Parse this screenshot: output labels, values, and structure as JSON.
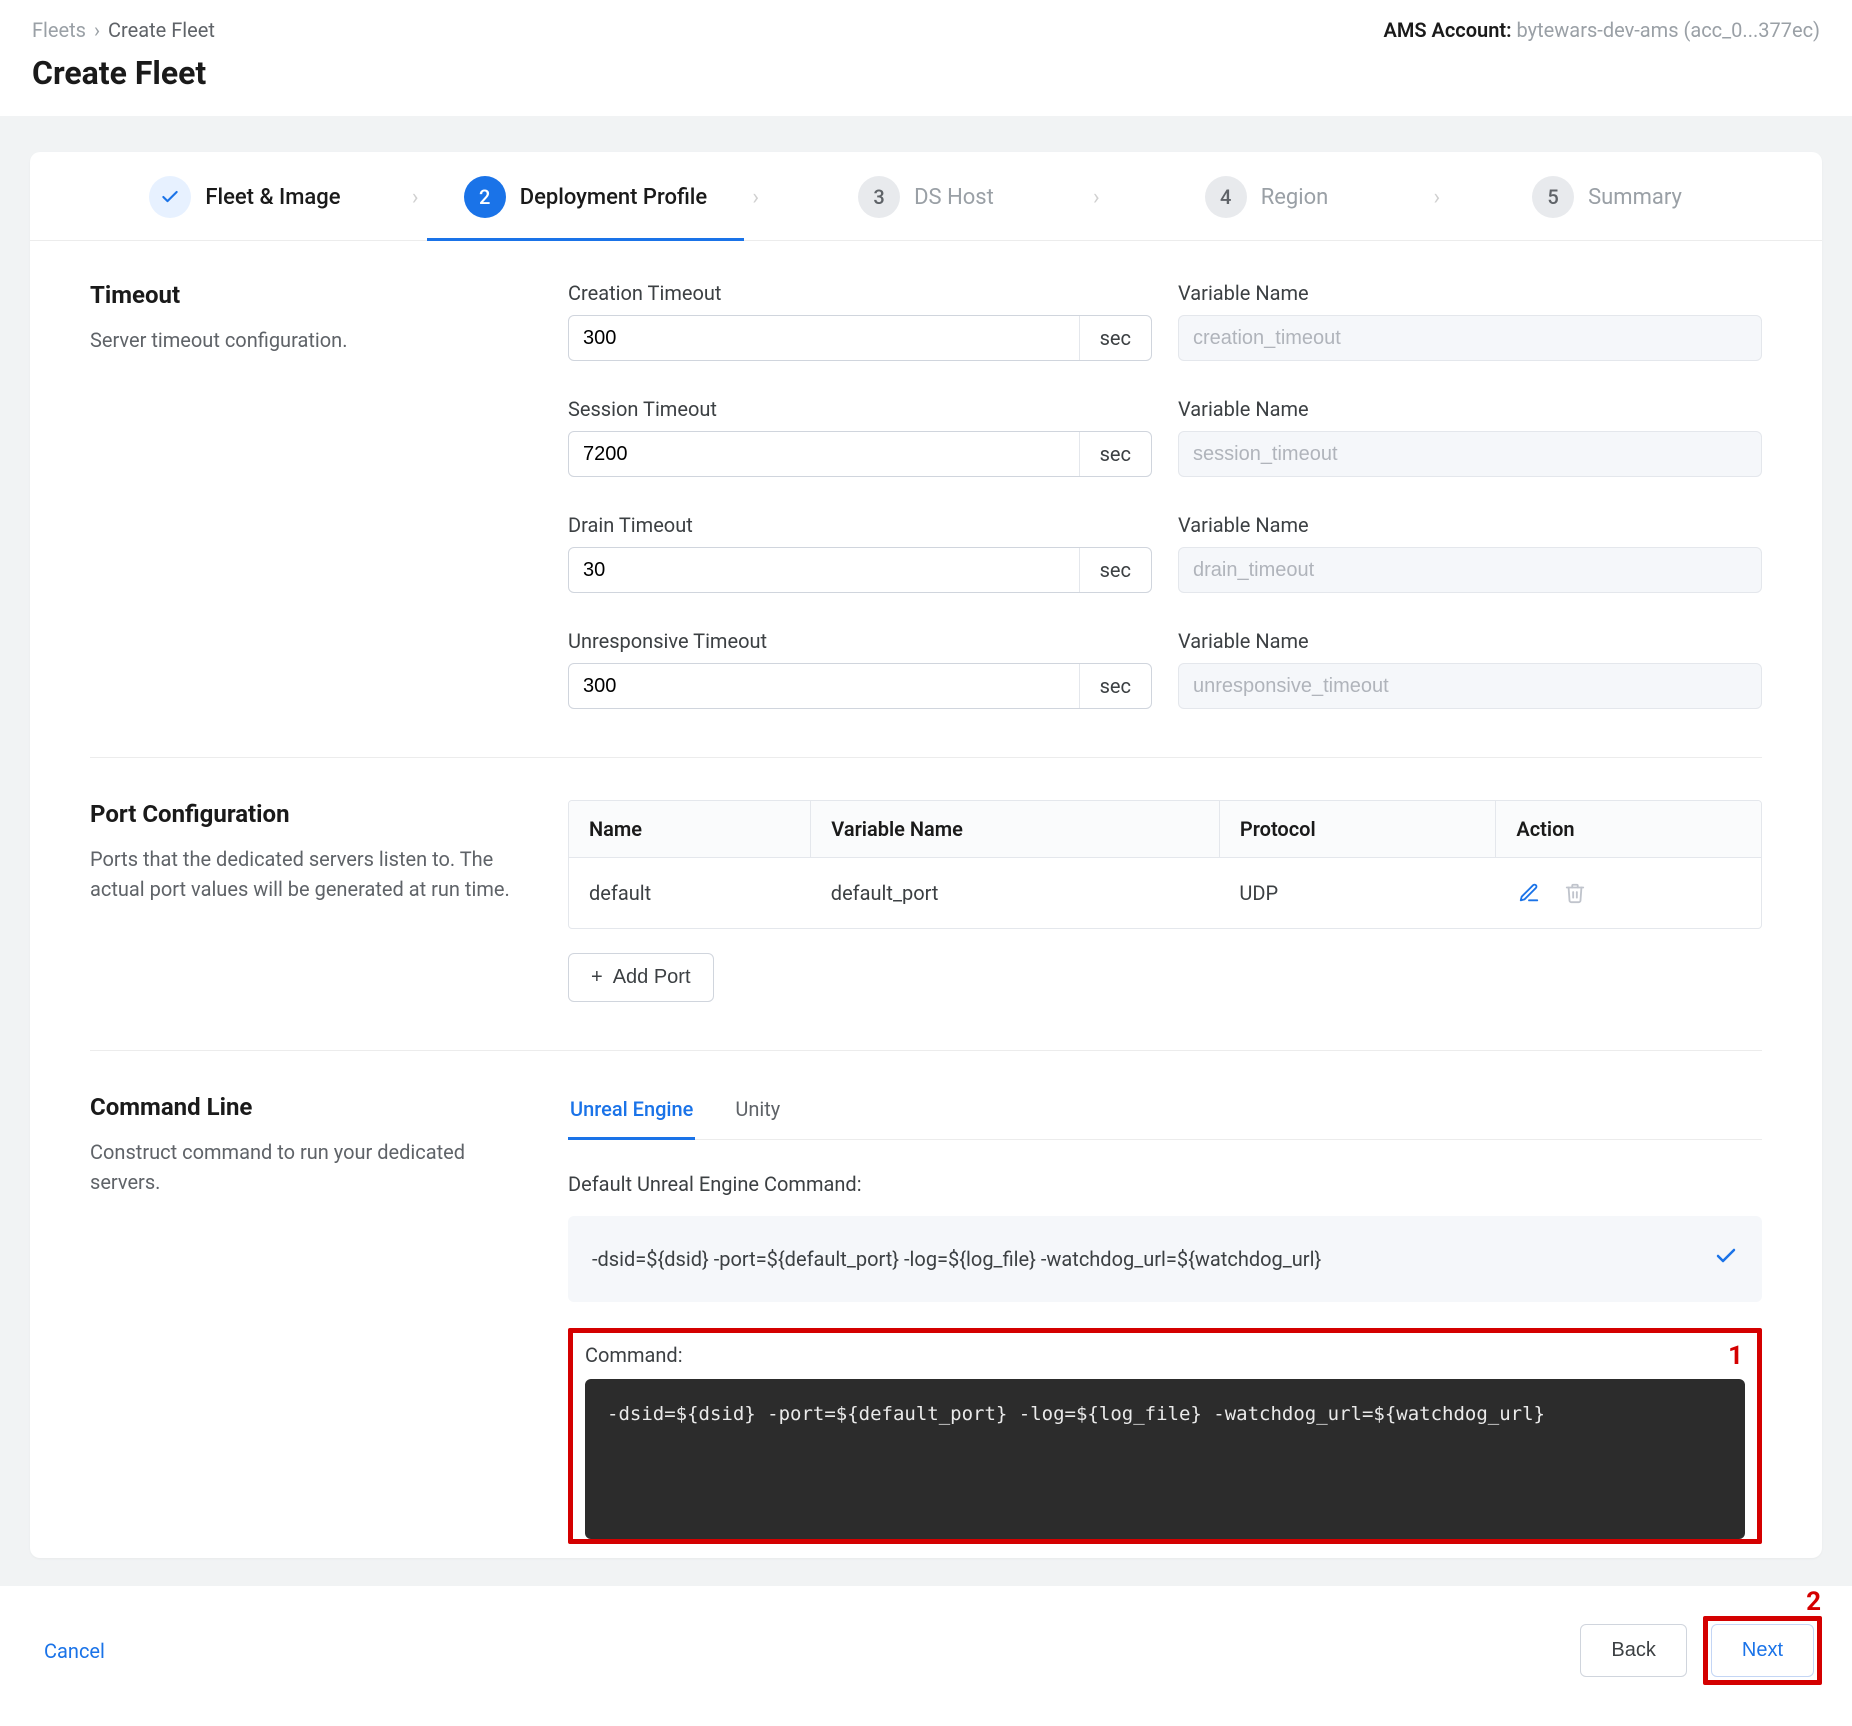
{
  "breadcrumb": {
    "root": "Fleets",
    "current": "Create Fleet"
  },
  "ams": {
    "label": "AMS Account:",
    "value": "bytewars-dev-ams (acc_0...377ec)"
  },
  "page_title": "Create Fleet",
  "stepper": {
    "steps": [
      {
        "num": "✓",
        "label": "Fleet & Image",
        "state": "completed"
      },
      {
        "num": "2",
        "label": "Deployment Profile",
        "state": "active"
      },
      {
        "num": "3",
        "label": "DS Host",
        "state": "upcoming"
      },
      {
        "num": "4",
        "label": "Region",
        "state": "upcoming"
      },
      {
        "num": "5",
        "label": "Summary",
        "state": "upcoming"
      }
    ]
  },
  "timeout": {
    "title": "Timeout",
    "desc": "Server timeout configuration.",
    "fields": [
      {
        "label": "Creation Timeout",
        "value": "300",
        "suffix": "sec",
        "var_label": "Variable Name",
        "var_placeholder": "creation_timeout"
      },
      {
        "label": "Session Timeout",
        "value": "7200",
        "suffix": "sec",
        "var_label": "Variable Name",
        "var_placeholder": "session_timeout"
      },
      {
        "label": "Drain Timeout",
        "value": "30",
        "suffix": "sec",
        "var_label": "Variable Name",
        "var_placeholder": "drain_timeout"
      },
      {
        "label": "Unresponsive Timeout",
        "value": "300",
        "suffix": "sec",
        "var_label": "Variable Name",
        "var_placeholder": "unresponsive_timeout"
      }
    ]
  },
  "ports": {
    "title": "Port Configuration",
    "desc": "Ports that the dedicated servers listen to. The actual port values will be generated at run time.",
    "columns": {
      "name": "Name",
      "var": "Variable Name",
      "proto": "Protocol",
      "action": "Action"
    },
    "rows": [
      {
        "name": "default",
        "var": "default_port",
        "proto": "UDP"
      }
    ],
    "add_label": "Add Port"
  },
  "cmd": {
    "title": "Command Line",
    "desc": "Construct command to run your dedicated servers.",
    "tabs": {
      "unreal": "Unreal Engine",
      "unity": "Unity"
    },
    "default_label": "Default Unreal Engine Command:",
    "default_value": "-dsid=${dsid} -port=${default_port} -log=${log_file} -watchdog_url=${watchdog_url}",
    "command_label": "Command:",
    "command_value": "-dsid=${dsid} -port=${default_port} -log=${log_file} -watchdog_url=${watchdog_url}"
  },
  "footer": {
    "cancel": "Cancel",
    "back": "Back",
    "next": "Next"
  },
  "markers": {
    "one": "1",
    "two": "2"
  },
  "icons": {
    "plus": "+",
    "check": "✓",
    "chevron": "›"
  }
}
